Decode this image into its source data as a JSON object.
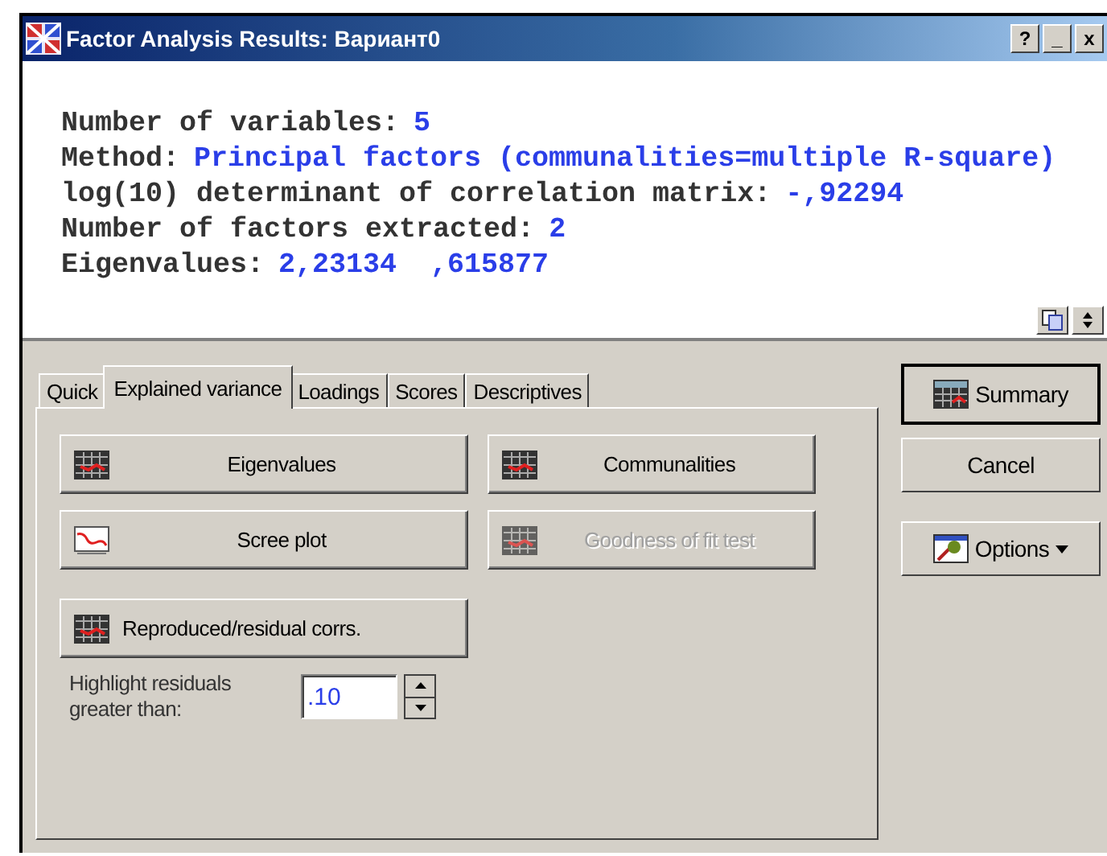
{
  "window": {
    "title": "Factor Analysis Results: Вариант0",
    "title_buttons": [
      "?",
      "_",
      "x"
    ]
  },
  "output": {
    "lines": [
      {
        "label": "Number of variables:",
        "value": "5"
      },
      {
        "label": "Method:",
        "value": "Principal factors (communalities=multiple R-square)"
      },
      {
        "label": "log(10) determinant of correlation matrix:",
        "value": "-,92294"
      },
      {
        "label": "Number of factors extracted:",
        "value": "2"
      },
      {
        "label": "Eigenvalues:",
        "value": "2,23134  ,615877"
      }
    ]
  },
  "tabs": [
    {
      "label": "Quick",
      "selected": false
    },
    {
      "label": "Explained variance",
      "selected": true
    },
    {
      "label": "Loadings",
      "selected": false
    },
    {
      "label": "Scores",
      "selected": false
    },
    {
      "label": "Descriptives",
      "selected": false
    }
  ],
  "buttons": [
    {
      "label": "Eigenvalues",
      "kind": "table",
      "disabled": false
    },
    {
      "label": "Communalities",
      "kind": "table",
      "disabled": false
    },
    {
      "label": "Scree plot",
      "kind": "plot",
      "disabled": false
    },
    {
      "label": "Goodness of fit test",
      "kind": "table",
      "disabled": true
    },
    {
      "label": "Reproduced/residual corrs.",
      "kind": "matrix",
      "disabled": false
    }
  ],
  "highlight": {
    "label": "Highlight residuals greater than:",
    "value": ".10"
  },
  "side_buttons": [
    {
      "label": "Summary",
      "kind": "summary",
      "default": true
    },
    {
      "label": "Cancel",
      "kind": "plain",
      "default": false
    },
    {
      "label": "Options",
      "kind": "options",
      "default": false
    }
  ]
}
